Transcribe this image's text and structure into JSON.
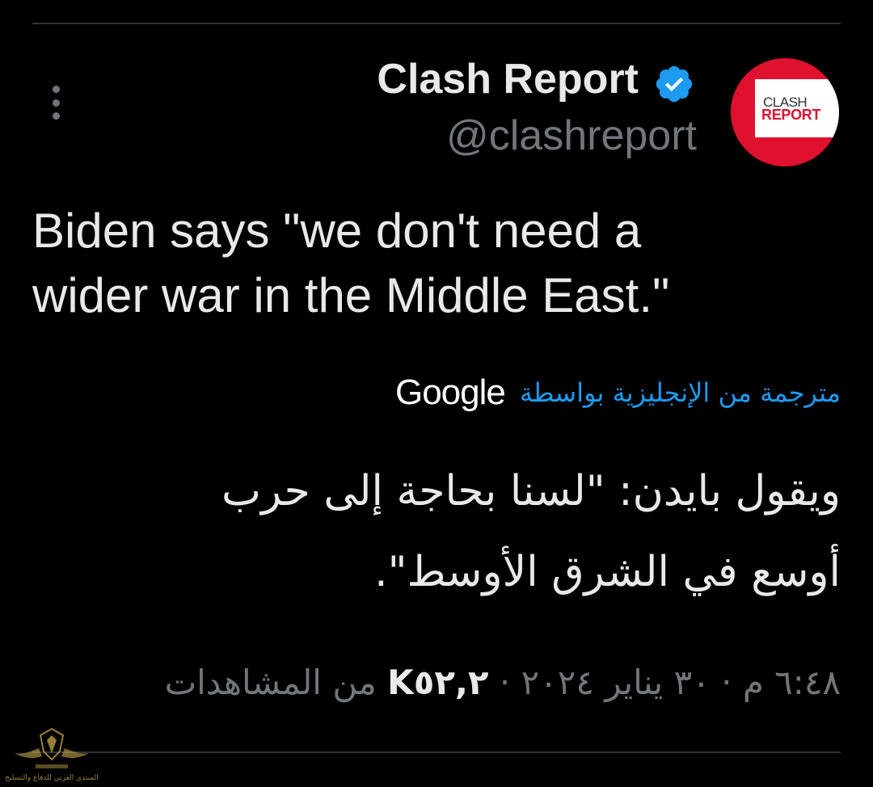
{
  "author": {
    "display_name": "Clash Report",
    "handle": "@clashreport",
    "verified": true,
    "avatar_line1": "CLASH",
    "avatar_line2": "REPORT"
  },
  "tweet": {
    "text": "Biden says \"we don't need a\nwider war in the Middle East.\""
  },
  "translation": {
    "label": "مترجمة من الإنجليزية بواسطة",
    "provider": "Google",
    "text": "ويقول بايدن: \"لسنا بحاجة إلى حرب\nأوسع في الشرق الأوسط\"."
  },
  "meta": {
    "time": "٦:٤٨ م",
    "separator": "·",
    "date": "٣٠ يناير ٢٠٢٤",
    "views_count": "K٥٢,٢",
    "views_label": "من المشاهدات"
  },
  "watermark": {
    "text": "المنتدى العربي للدفاع والتسليح"
  },
  "colors": {
    "background": "#000000",
    "text": "#e7e9ea",
    "secondary": "#71767b",
    "accent": "#1d9bf0",
    "avatar_red": "#e0102f"
  },
  "icons": {
    "more": "more-vertical-icon",
    "verified": "verified-badge-icon"
  }
}
